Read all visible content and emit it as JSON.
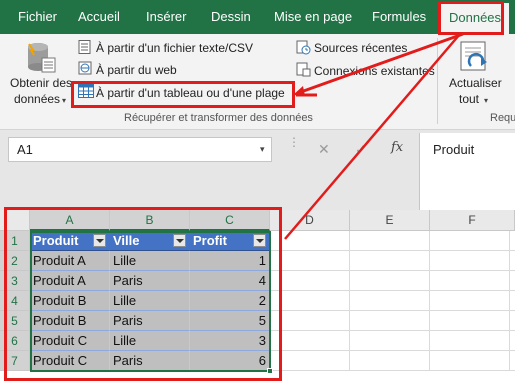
{
  "tabs": [
    "Fichier",
    "Accueil",
    "Insérer",
    "Dessin",
    "Mise en page",
    "Formules",
    "Données"
  ],
  "active_tab": "Données",
  "ribbon": {
    "get_data": [
      "Obtenir des",
      "données"
    ],
    "from_text_csv": "À partir d'un fichier texte/CSV",
    "from_web": "À partir du web",
    "from_table": "À partir d'un tableau ou d'une plage",
    "recent_sources": "Sources récentes",
    "existing_connections": "Connexions existantes",
    "group_label": "Récupérer et transformer des données",
    "refresh": [
      "Actualiser",
      "tout"
    ],
    "group_label_cut": "Requ"
  },
  "formula_bar": {
    "name_box": "A1",
    "fx": "fx",
    "value": "Produit"
  },
  "sheet": {
    "columns": [
      "A",
      "B",
      "C",
      "D",
      "E",
      "F"
    ],
    "rows": [
      "1",
      "2",
      "3",
      "4",
      "5",
      "6",
      "7"
    ],
    "headers": [
      "Produit",
      "Ville",
      "Profit"
    ],
    "data": [
      [
        "Produit A",
        "Lille",
        "1"
      ],
      [
        "Produit A",
        "Paris",
        "4"
      ],
      [
        "Produit B",
        "Lille",
        "2"
      ],
      [
        "Produit B",
        "Paris",
        "5"
      ],
      [
        "Produit C",
        "Lille",
        "3"
      ],
      [
        "Produit C",
        "Paris",
        "6"
      ]
    ]
  },
  "colors": {
    "excel_green": "#217346",
    "table_header": "#4472c4",
    "highlight": "#e21b1b"
  }
}
